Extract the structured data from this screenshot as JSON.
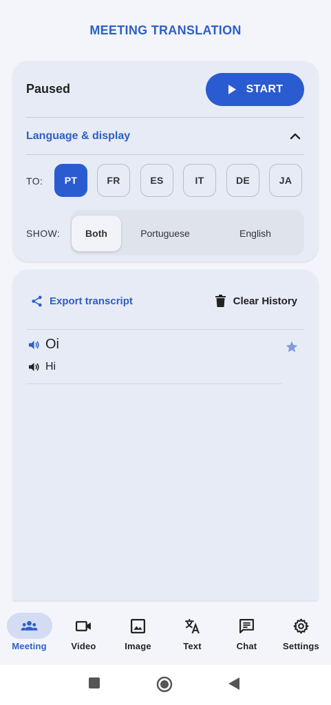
{
  "app": {
    "title": "MEETING TRANSLATION"
  },
  "session": {
    "status": "Paused",
    "start_label": "START"
  },
  "settings": {
    "section_label": "Language & display",
    "to_label": "TO:",
    "languages": [
      "PT",
      "FR",
      "ES",
      "IT",
      "DE",
      "JA"
    ],
    "selected_language": "PT",
    "show_label": "SHOW:",
    "show_options": [
      "Both",
      "Portuguese",
      "English"
    ],
    "selected_show": "Both"
  },
  "history": {
    "export_label": "Export transcript",
    "clear_label": "Clear History",
    "entries": [
      {
        "source": "Oi",
        "translation": "Hi",
        "starred": true
      }
    ]
  },
  "nav": {
    "items": [
      "Meeting",
      "Video",
      "Image",
      "Text",
      "Chat",
      "Settings"
    ],
    "active": "Meeting"
  },
  "colors": {
    "accent": "#2b5bd1",
    "title": "#2d5fc4",
    "card": "#e6ebf6",
    "active_nav": "#d3dcf3"
  },
  "icons": [
    "play-icon",
    "chevron-up-icon",
    "share-icon",
    "trash-icon",
    "speaker-icon",
    "star-icon",
    "group-icon",
    "video-camera-icon",
    "image-icon",
    "translate-icon",
    "chat-icon",
    "gear-icon",
    "square-icon",
    "circle-icon",
    "back-triangle-icon"
  ]
}
